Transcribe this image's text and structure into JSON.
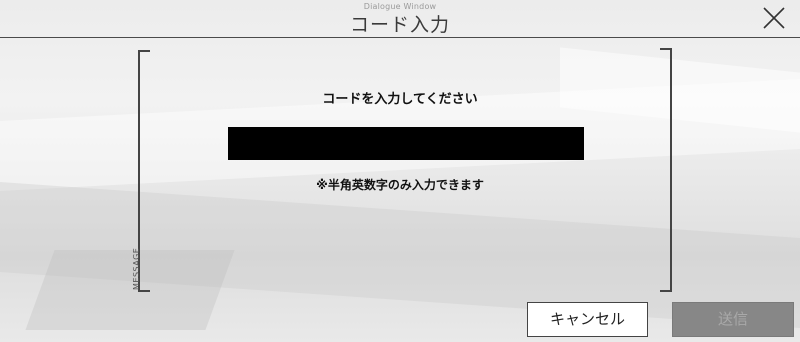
{
  "dialog": {
    "caption": "Dialogue Window",
    "title": "コード入力",
    "side_label": "MESSAGE",
    "prompt": "コードを入力してください",
    "input_value": "",
    "note": "※半角英数字のみ入力できます"
  },
  "buttons": {
    "cancel_label": "キャンセル",
    "send_label": "送信"
  },
  "icons": {
    "close": "close-icon"
  },
  "colors": {
    "input_background": "#000000",
    "send_button_background": "#878787",
    "cancel_button_background": "#ffffff"
  }
}
